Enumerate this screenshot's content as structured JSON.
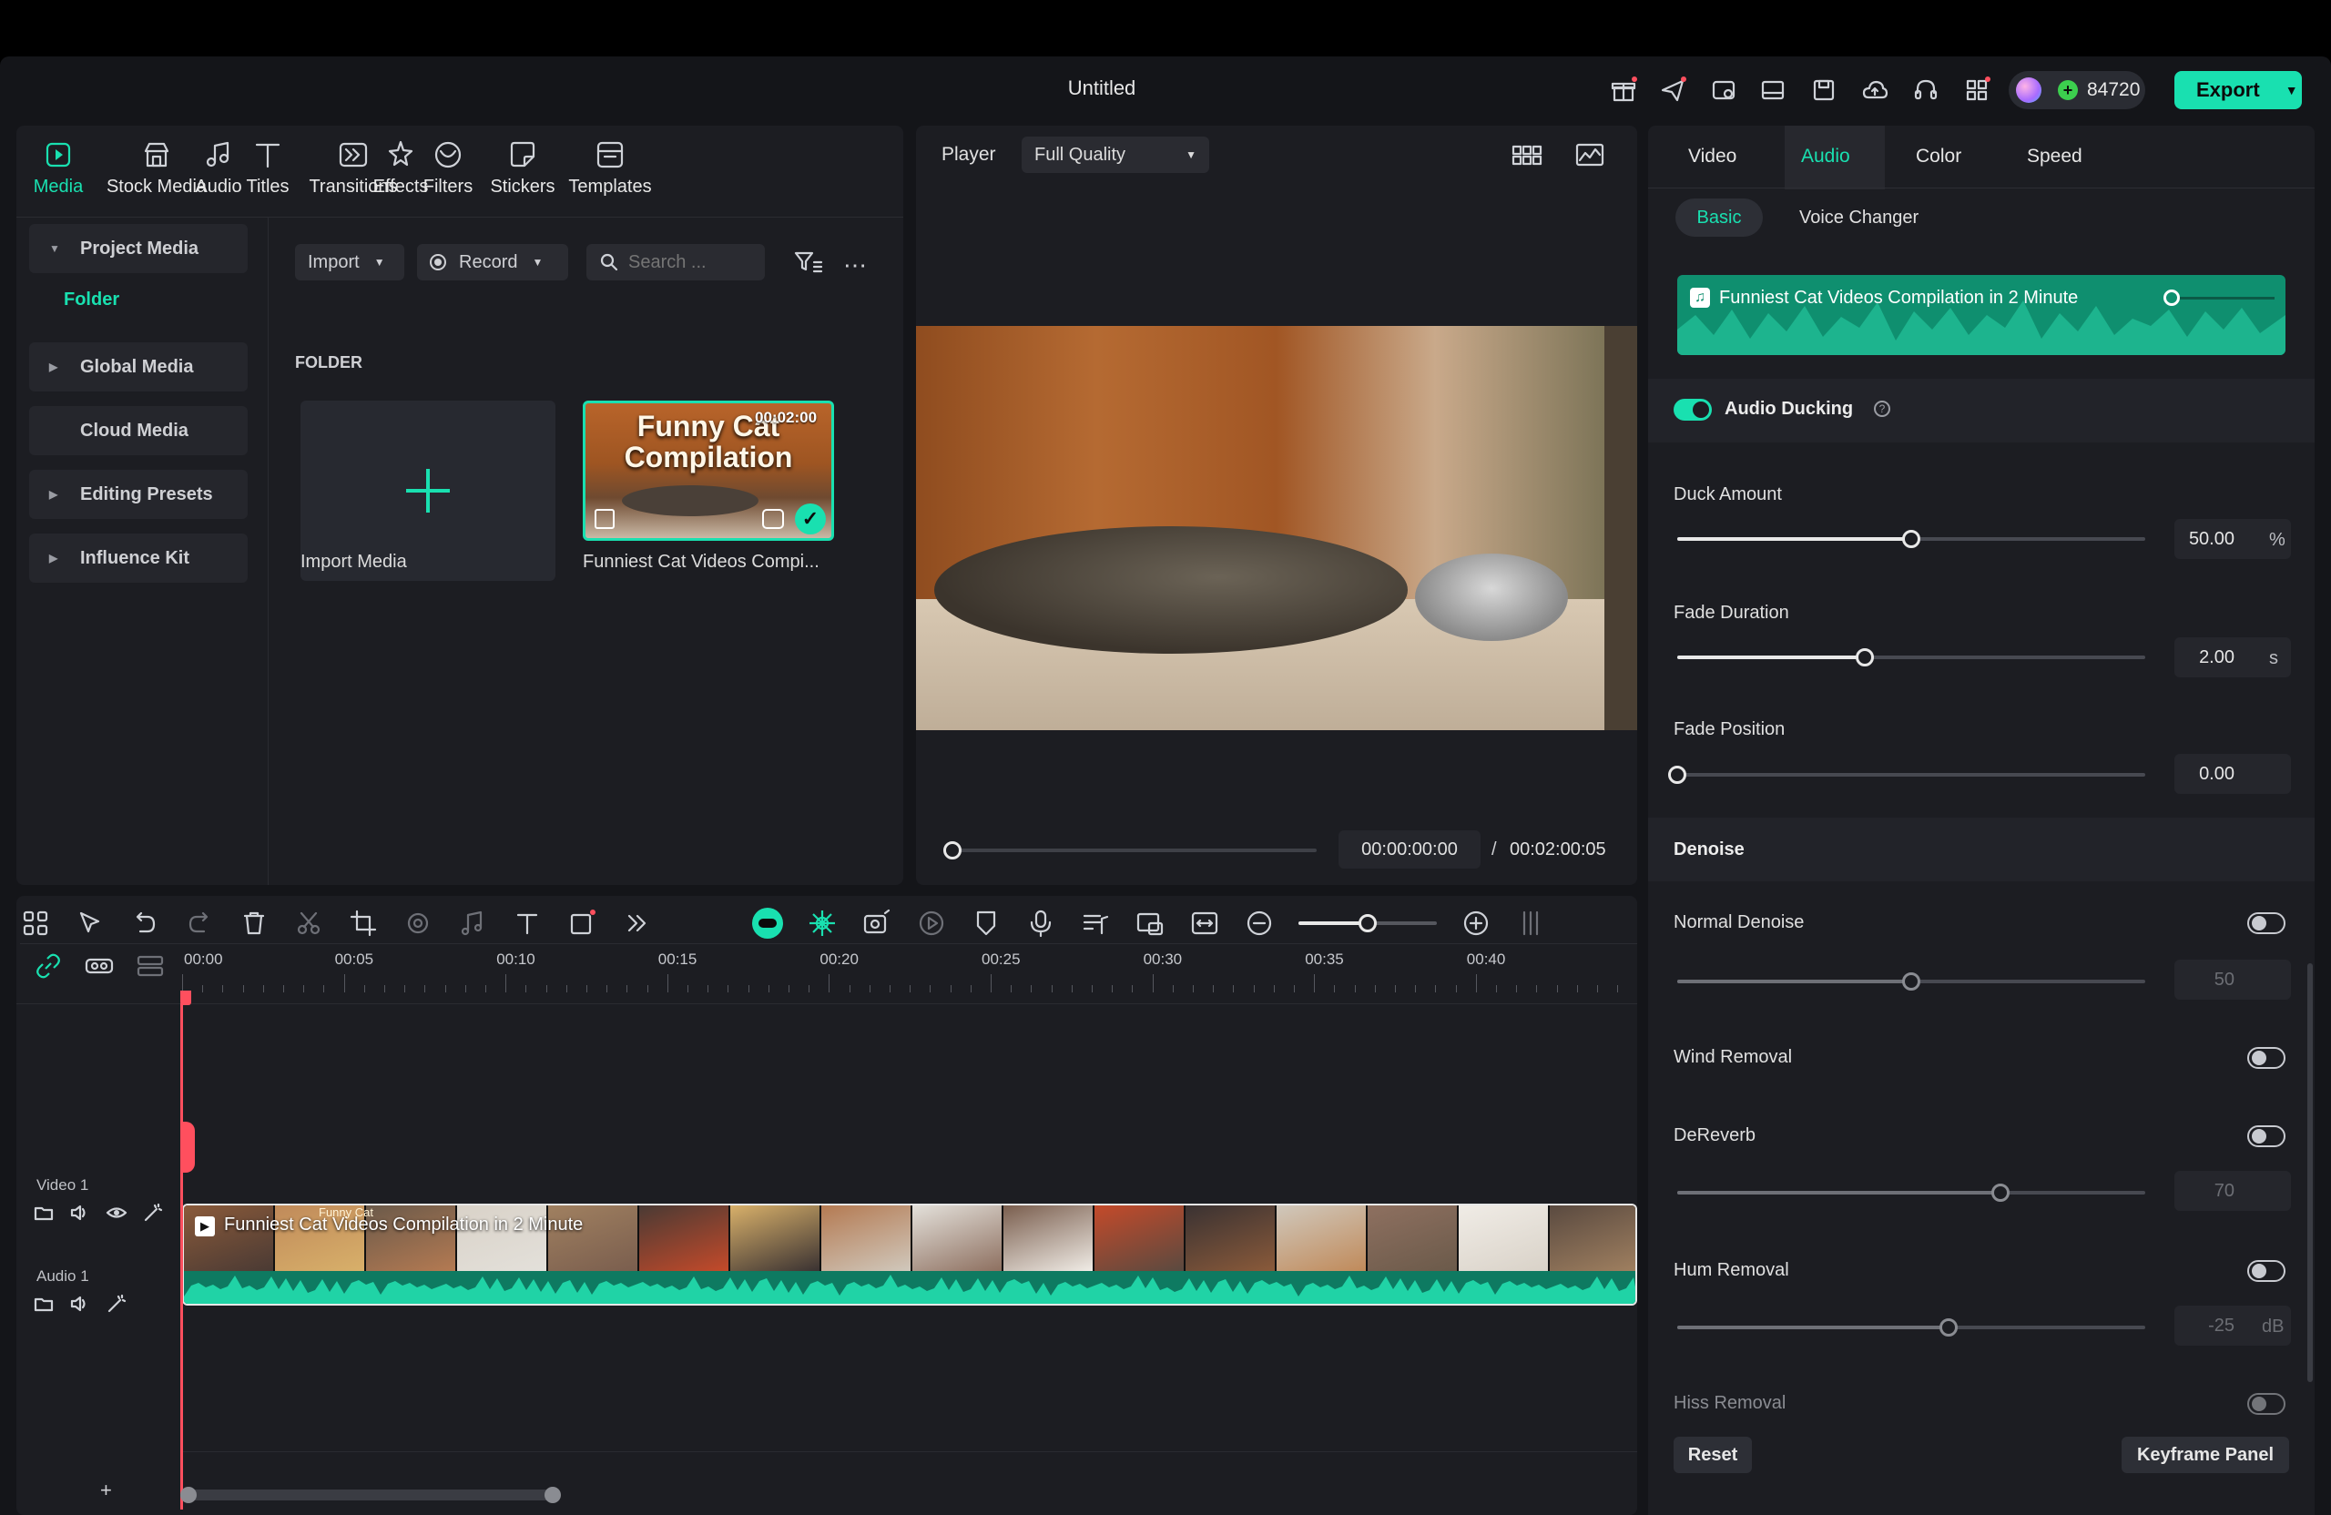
{
  "app": {
    "title": "Untitled",
    "credits": "84720",
    "export_label": "Export"
  },
  "media_tabs": [
    {
      "label": "Media",
      "icon": "media-icon",
      "active": true
    },
    {
      "label": "Stock Media",
      "icon": "stock-media-icon"
    },
    {
      "label": "Audio",
      "icon": "music-note-icon"
    },
    {
      "label": "Titles",
      "icon": "titles-icon"
    },
    {
      "label": "Transitions",
      "icon": "transitions-icon"
    },
    {
      "label": "Effects",
      "icon": "effects-icon"
    },
    {
      "label": "Filters",
      "icon": "filters-icon"
    },
    {
      "label": "Stickers",
      "icon": "stickers-icon"
    },
    {
      "label": "Templates",
      "icon": "templates-icon"
    }
  ],
  "media_sidebar": {
    "project_media": "Project Media",
    "folder": "Folder",
    "global_media": "Global Media",
    "cloud_media": "Cloud Media",
    "editing_presets": "Editing Presets",
    "influence_kit": "Influence Kit"
  },
  "media_toolbar": {
    "import": "Import",
    "record": "Record",
    "search_placeholder": "Search ..."
  },
  "media_grid": {
    "folder_heading": "FOLDER",
    "import_label": "Import Media",
    "clip": {
      "thumb_title": "Funny Cat Compilation",
      "duration": "00:02:00",
      "name": "Funniest Cat Videos Compi..."
    }
  },
  "player": {
    "label": "Player",
    "quality": "Full Quality",
    "current_time": "00:00:00:00",
    "total_time": "00:02:00:05",
    "separator": "/"
  },
  "properties": {
    "tabs": [
      "Video",
      "Audio",
      "Color",
      "Speed"
    ],
    "active_tab": "Audio",
    "subtabs": [
      "Basic",
      "Voice Changer"
    ],
    "audio_clip_name": "Funniest Cat Videos Compilation in 2 Minute",
    "audio_ducking": "Audio Ducking",
    "duck_amount": {
      "label": "Duck Amount",
      "value": "50.00",
      "unit": "%",
      "fraction": 0.5
    },
    "fade_duration": {
      "label": "Fade Duration",
      "value": "2.00",
      "unit": "s",
      "fraction": 0.4
    },
    "fade_position": {
      "label": "Fade Position",
      "value": "0.00",
      "fraction": 0.0
    },
    "denoise_heading": "Denoise",
    "normal_denoise": {
      "label": "Normal Denoise",
      "value": "50",
      "fraction": 0.5
    },
    "wind_removal": {
      "label": "Wind Removal"
    },
    "dereverb": {
      "label": "DeReverb",
      "value": "70",
      "fraction": 0.69
    },
    "hum_removal": {
      "label": "Hum Removal",
      "value": "-25",
      "unit": "dB",
      "fraction": 0.58
    },
    "hiss_removal": {
      "label": "Hiss Removal"
    },
    "reset": "Reset",
    "keyframe_panel": "Keyframe Panel"
  },
  "timeline": {
    "ruler": [
      "00:00",
      "00:05",
      "00:10",
      "00:15",
      "00:20",
      "00:25",
      "00:30",
      "00:35",
      "00:40"
    ],
    "tracks": {
      "video": "Video 1",
      "audio": "Audio 1"
    },
    "clip_label": "Funniest Cat Videos Compilation in 2 Minute",
    "thumb_caption": "Funny Cat"
  },
  "colors": {
    "accent": "#19e0b0",
    "playhead": "#ff4f5e",
    "panel": "#1c1d22"
  }
}
